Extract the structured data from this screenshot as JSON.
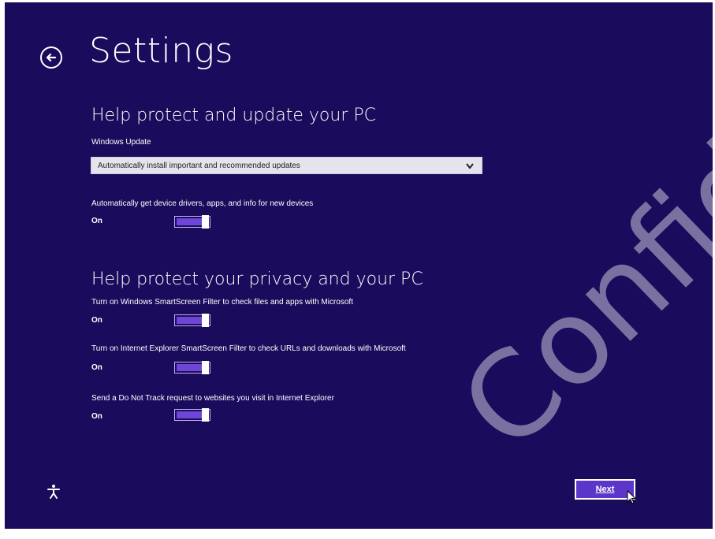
{
  "header": {
    "title": "Settings"
  },
  "update_section": {
    "title": "Help protect and update your PC",
    "windows_update_label": "Windows Update",
    "windows_update_value": "Automatically install important and recommended updates",
    "drivers_label": "Automatically get device drivers, apps, and info for new devices",
    "drivers_state": "On",
    "drivers_on": true
  },
  "privacy_section": {
    "title": "Help protect your privacy and your PC",
    "items": [
      {
        "label": "Turn on Windows SmartScreen Filter to check files and apps with Microsoft",
        "state": "On",
        "on": true
      },
      {
        "label": "Turn on Internet Explorer SmartScreen Filter to check URLs and downloads with Microsoft",
        "state": "On",
        "on": true
      },
      {
        "label": "Send a Do Not Track request to websites you visit in Internet Explorer",
        "state": "On",
        "on": true
      }
    ]
  },
  "footer": {
    "next_label": "Next"
  },
  "icons": {
    "back": "back-arrow-circle-icon",
    "dropdown": "chevron-down-icon",
    "ease_of_access": "ease-of-access-icon",
    "cursor": "mouse-pointer-icon"
  },
  "watermark": "Confidential",
  "colors": {
    "background": "#1b0b5c",
    "accent": "#6d46d8",
    "button": "#5b36c9",
    "select_bg": "#e5e3ec"
  }
}
